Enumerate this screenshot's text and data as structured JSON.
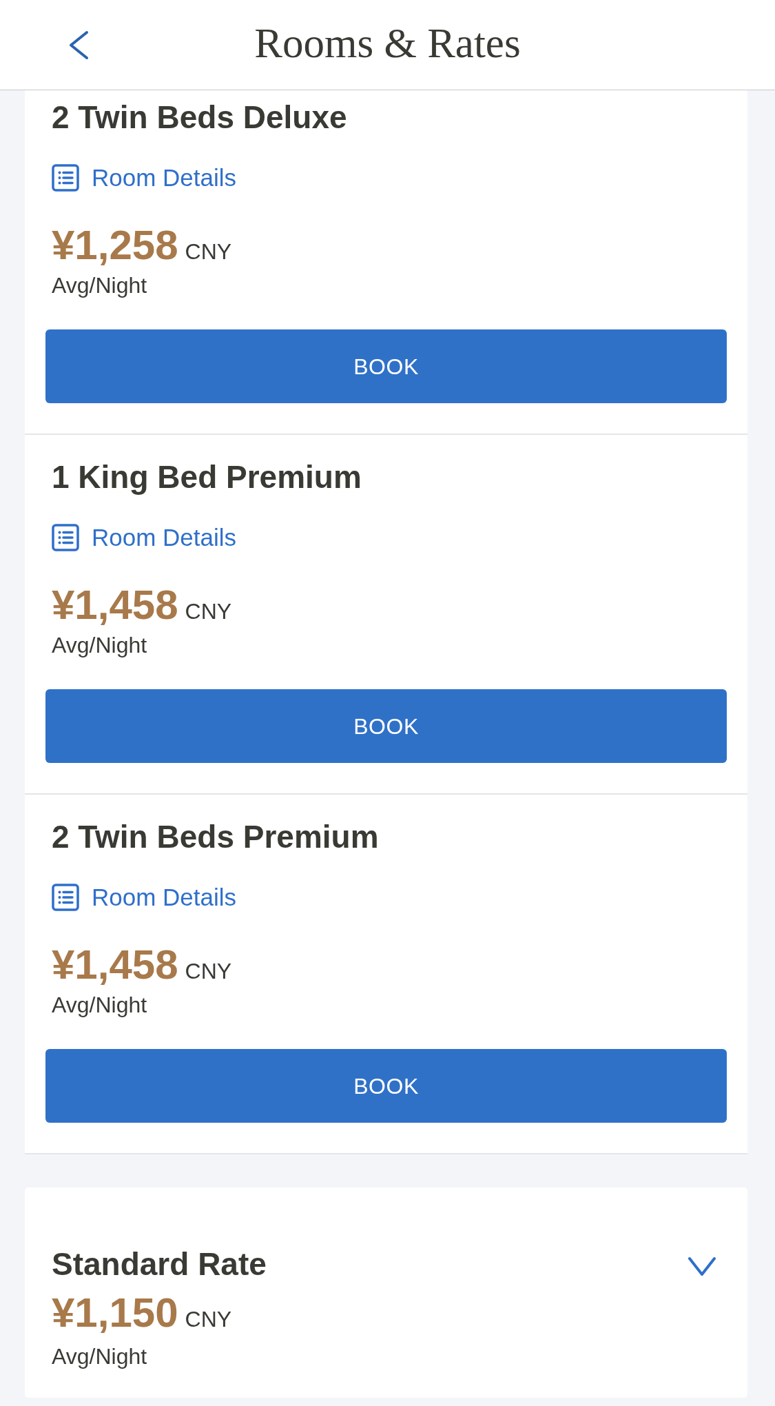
{
  "header": {
    "title": "Rooms & Rates"
  },
  "rooms": [
    {
      "name": "2 Twin Beds Deluxe",
      "details_link": "Room Details",
      "price": "¥1,258",
      "currency": "CNY",
      "price_note": "Avg/Night",
      "button": "BOOK"
    },
    {
      "name": "1 King Bed Premium",
      "details_link": "Room Details",
      "price": "¥1,458",
      "currency": "CNY",
      "price_note": "Avg/Night",
      "button": "BOOK"
    },
    {
      "name": "2 Twin Beds Premium",
      "details_link": "Room Details",
      "price": "¥1,458",
      "currency": "CNY",
      "price_note": "Avg/Night",
      "button": "BOOK"
    }
  ],
  "rates": [
    {
      "name": "Standard Rate",
      "price": "¥1,150",
      "currency": "CNY",
      "price_note": "Avg/Night",
      "expanded": false
    }
  ]
}
